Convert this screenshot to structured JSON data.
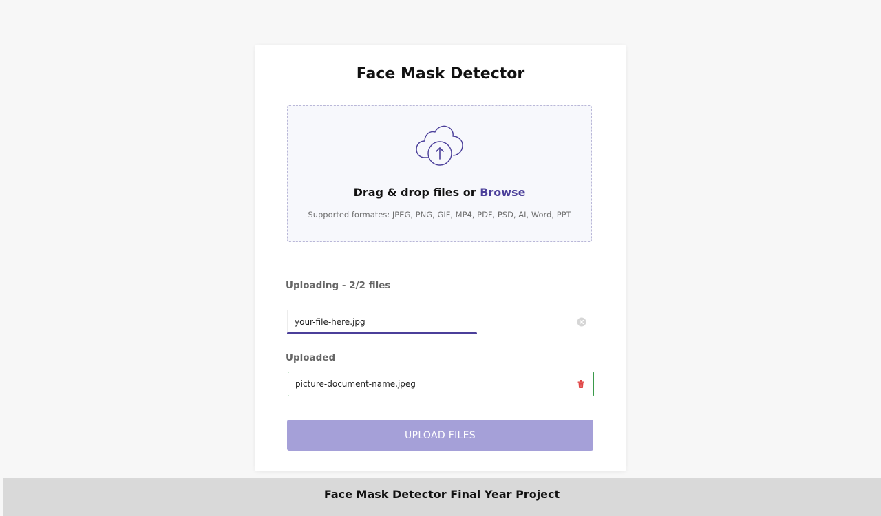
{
  "app": {
    "title": "Face Mask Detector"
  },
  "dropzone": {
    "prompt": "Drag & drop files or",
    "browse_label": "Browse",
    "formats_text": "Supported formates: JPEG, PNG, GIF, MP4, PDF, PSD, AI, Word, PPT",
    "icon": "cloud-upload-icon"
  },
  "uploading": {
    "label": "Uploading - 2/2 files",
    "file_name": "your-file-here.jpg",
    "progress": 0.62,
    "clear_icon": "close-circle-icon"
  },
  "uploaded": {
    "label": "Uploaded",
    "file_name": "picture-document-name.jpeg",
    "delete_icon": "trash-icon"
  },
  "actions": {
    "upload_label": "UPLOAD FILES"
  },
  "footer": {
    "text": "Face Mask Detector Final Year Project"
  },
  "colors": {
    "accent": "#4b3f9a",
    "button": "#a5a0d8",
    "success_border": "#3a9a4b",
    "delete": "#e04646"
  }
}
